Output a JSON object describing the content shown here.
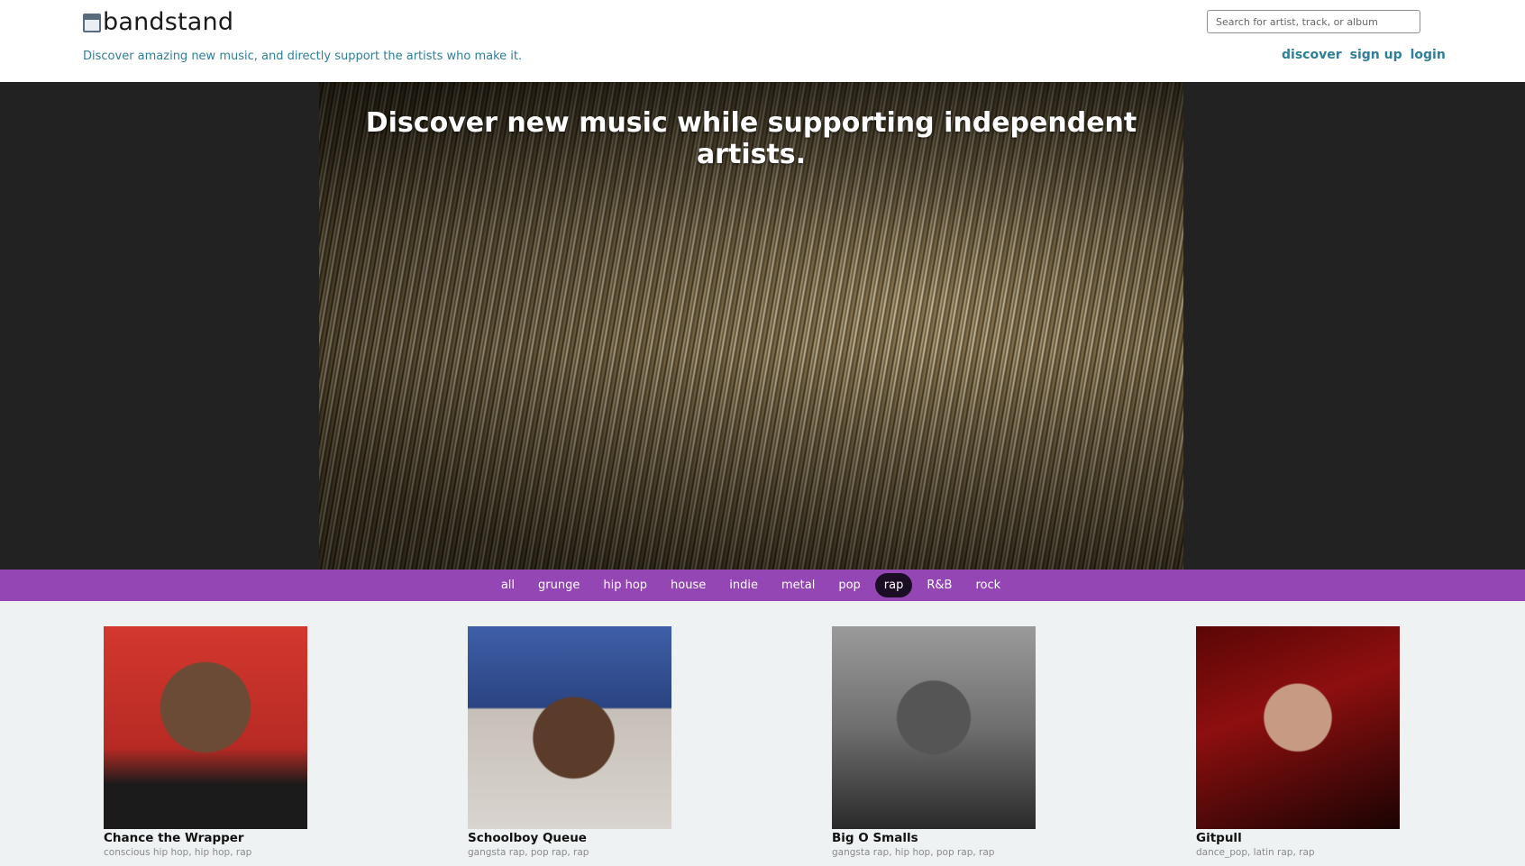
{
  "header": {
    "brand": "bandstand",
    "tagline": "Discover amazing new music, and directly support the artists who make it.",
    "search_placeholder": "Search for artist, track, or album",
    "nav": [
      {
        "label": "discover"
      },
      {
        "label": "sign up"
      },
      {
        "label": "login"
      }
    ]
  },
  "hero": {
    "title": "Discover new music while supporting independent artists."
  },
  "genres": {
    "active": "rap",
    "items": [
      "all",
      "grunge",
      "hip hop",
      "house",
      "indie",
      "metal",
      "pop",
      "rap",
      "R&B",
      "rock"
    ]
  },
  "artists": [
    {
      "name": "Chance the Wrapper",
      "tags": "conscious hip hop, hip hop, rap"
    },
    {
      "name": "Schoolboy Queue",
      "tags": "gangsta rap, pop rap, rap"
    },
    {
      "name": "Big O Smalls",
      "tags": "gangsta rap, hip hop, pop rap, rap"
    },
    {
      "name": "Gitpull",
      "tags": "dance_pop, latin rap, rap"
    }
  ],
  "colors": {
    "accent": "#2e7f9a",
    "genre_bar": "#9346b4",
    "genre_active": "#1b0d24",
    "hero_bg": "#222222",
    "page_bg": "#eef2f2"
  }
}
